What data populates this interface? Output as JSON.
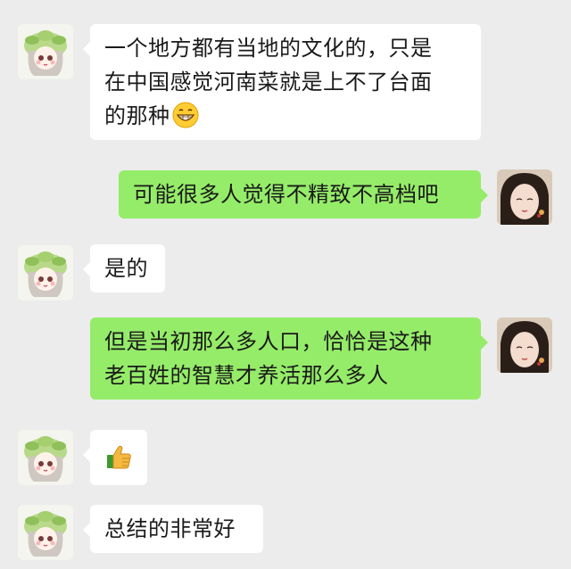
{
  "chat": {
    "messages": [
      {
        "side": "left",
        "lines": [
          "一个地方都有当地的文化的，只是",
          "在中国感觉河南菜就是上不了台面",
          "的那种"
        ],
        "emoji": "grinning-emoji"
      },
      {
        "side": "right",
        "lines": [
          "可能很多人觉得不精致不高档吧"
        ]
      },
      {
        "side": "left",
        "lines": [
          "是的"
        ]
      },
      {
        "side": "right",
        "lines": [
          "但是当初那么多人口，恰恰是这种",
          "老百姓的智慧才养活那么多人"
        ]
      },
      {
        "side": "left",
        "lines": [],
        "emoji": "thumbs-up-emoji"
      },
      {
        "side": "left",
        "lines": [
          "总结的非常好"
        ]
      }
    ]
  },
  "colors": {
    "background": "#ececec",
    "left_bubble": "#ffffff",
    "right_bubble": "#95ec69"
  }
}
